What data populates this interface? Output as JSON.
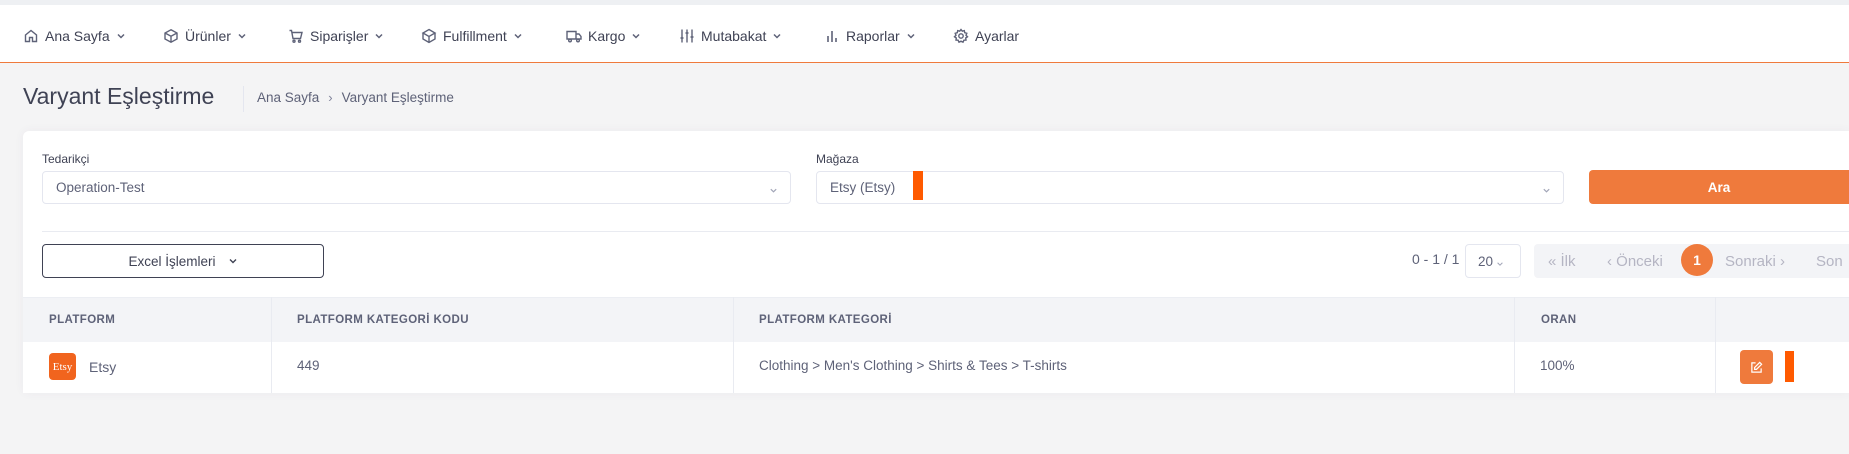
{
  "nav": {
    "items": [
      {
        "label": "Ana Sayfa",
        "icon": "home-icon"
      },
      {
        "label": "Ürünler",
        "icon": "box-icon"
      },
      {
        "label": "Siparişler",
        "icon": "cart-icon"
      },
      {
        "label": "Fulfillment",
        "icon": "cube-icon"
      },
      {
        "label": "Kargo",
        "icon": "truck-icon"
      },
      {
        "label": "Mutabakat",
        "icon": "sliders-icon"
      },
      {
        "label": "Raporlar",
        "icon": "bar-chart-icon"
      },
      {
        "label": "Ayarlar",
        "icon": "gear-icon"
      }
    ]
  },
  "page": {
    "title": "Varyant Eşleştirme",
    "breadcrumb": [
      "Ana Sayfa",
      "Varyant Eşleştirme"
    ]
  },
  "filters": {
    "supplier_label": "Tedarikçi",
    "supplier_value": "Operation-Test",
    "store_label": "Mağaza",
    "store_value": "Etsy (Etsy)",
    "search_label": "Ara"
  },
  "toolbar": {
    "excel_label": "Excel İşlemleri",
    "range_text": "0 - 1 / 1",
    "page_size": "20"
  },
  "pagination": {
    "first": "« İlk",
    "prev": "‹ Önceki",
    "current": "1",
    "next": "Sonraki ›",
    "last": "Son"
  },
  "table": {
    "columns": [
      "PLATFORM",
      "PLATFORM KATEGORİ KODU",
      "PLATFORM KATEGORİ",
      "ORAN"
    ],
    "rows": [
      {
        "platform": "Etsy",
        "platform_logo_text": "Etsy",
        "category_code": "449",
        "category": "Clothing > Men's Clothing > Shirts & Tees > T-shirts",
        "ratio": "100%"
      }
    ]
  },
  "colors": {
    "accent": "#ef7a3c",
    "marker": "#ff5a00",
    "etsy": "#f1641e"
  }
}
